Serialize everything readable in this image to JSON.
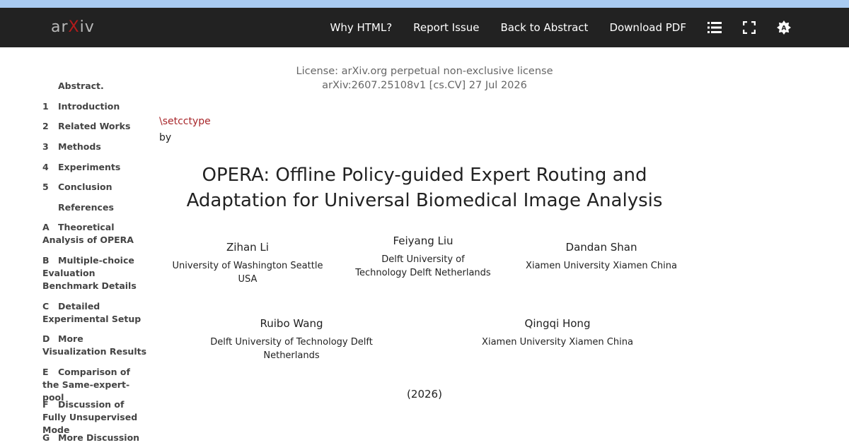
{
  "navbar": {
    "logo_prefix": "ar",
    "logo_x": "X",
    "logo_suffix": "iv",
    "links": [
      "Why HTML?",
      "Report Issue",
      "Back to Abstract",
      "Download PDF"
    ],
    "icons": [
      "list-icon",
      "fullscreen-icon",
      "theme-toggle-icon"
    ]
  },
  "toc": [
    {
      "num": "",
      "label": "Abstract."
    },
    {
      "num": "1",
      "label": "Introduction"
    },
    {
      "num": "2",
      "label": "Related Works"
    },
    {
      "num": "3",
      "label": "Methods"
    },
    {
      "num": "4",
      "label": "Experiments"
    },
    {
      "num": "5",
      "label": "Conclusion"
    },
    {
      "num": "",
      "label": "References"
    },
    {
      "num": "A",
      "label": "Theoretical Analysis of OPERA"
    },
    {
      "num": "B",
      "label": "Multiple-choice Evaluation Benchmark Details"
    },
    {
      "num": "C",
      "label": "Detailed Experimental Setup"
    },
    {
      "num": "D",
      "label": "More Visualization Results"
    },
    {
      "num": "E",
      "label": "Comparison of the Same-expert-pool"
    },
    {
      "num": "F",
      "label": "Discussion of Fully Unsupervised Mode"
    },
    {
      "num": "G",
      "label": "More Discussion"
    }
  ],
  "paper": {
    "license": "License: arXiv.org perpetual non-exclusive license",
    "arxiv_id": "arXiv:2607.25108v1 [cs.CV] 27 Jul 2026",
    "setcctype": "\\setcctype",
    "by": "by",
    "title_line1": "OPERA: Offline Policy-guided Expert Routing and",
    "title_line2": "Adaptation for Universal Biomedical Image Analysis",
    "authors": [
      {
        "name": "Zihan Li",
        "aff": "University of Washington Seattle USA"
      },
      {
        "name": "Feiyang Liu",
        "aff_line1": "Delft University of",
        "aff_line2": "Technology Delft Netherlands"
      },
      {
        "name": "Dandan Shan",
        "aff": "Xiamen University Xiamen China"
      },
      {
        "name": "Ruibo Wang",
        "aff": "Delft University of Technology Delft Netherlands"
      },
      {
        "name": "Qingqi Hong",
        "aff": "Xiamen University Xiamen China"
      }
    ],
    "year": "(2026)"
  },
  "colors": {
    "navbar_bg": "#222222",
    "top_strip": "#a9cbf1",
    "accent_red": "#b31b1b"
  }
}
